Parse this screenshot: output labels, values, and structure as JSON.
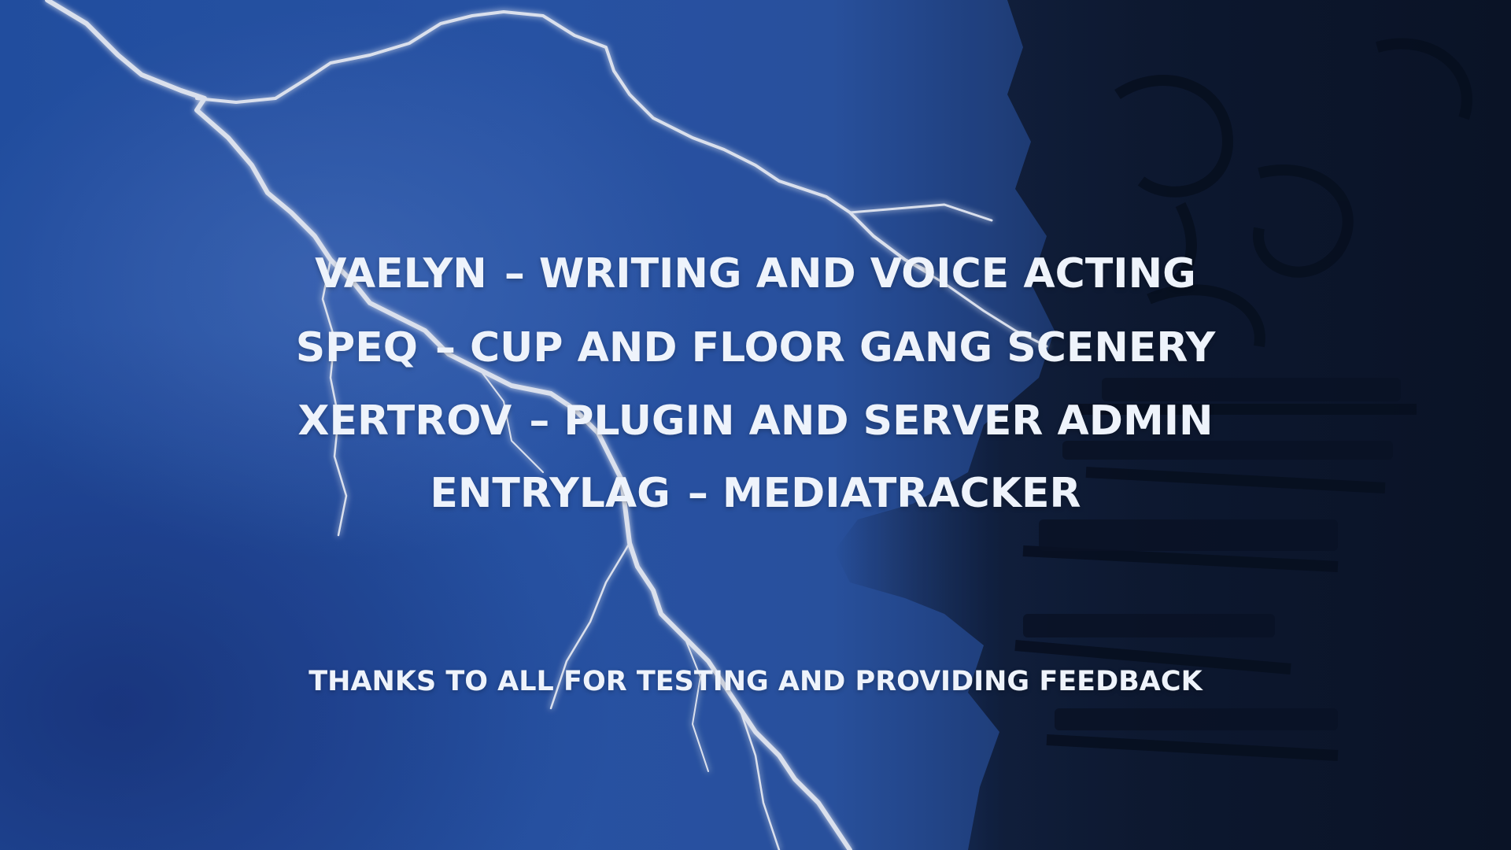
{
  "credits": [
    {
      "name": "VAELYN",
      "dash": "–",
      "role": "WRITING AND VOICE ACTING"
    },
    {
      "name": "SPEQ",
      "dash": "–",
      "role": "CUP AND FLOOR GANG SCENERY"
    },
    {
      "name": "XERTROV",
      "dash": "–",
      "role": "PLUGIN AND SERVER ADMIN"
    },
    {
      "name": "ENTRYLAG",
      "dash": "–",
      "role": "MEDIATRACKER"
    }
  ],
  "thanks": "THANKS TO ALL FOR TESTING AND PROVIDING FEEDBACK",
  "colors": {
    "sky_blue": "#2a58ae",
    "dark_navy": "#0f1c36",
    "text": "#eef3fb",
    "lightning": "#e8eefc"
  },
  "icons": [
    "lightning-bolt",
    "structure-silhouette"
  ]
}
